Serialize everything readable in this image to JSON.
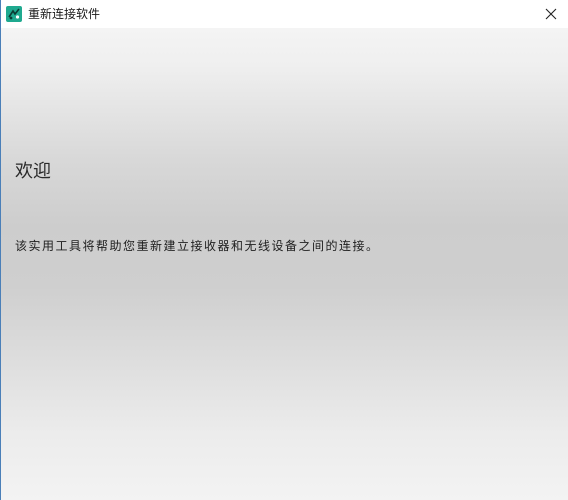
{
  "window": {
    "title": "重新连接软件",
    "icon": "logi-connect-icon",
    "close_label": "×"
  },
  "main": {
    "heading": "欢迎",
    "description": "该实用工具将帮助您重新建立接收器和无线设备之间的连接。"
  },
  "colors": {
    "accent": "#1fa98f",
    "border": "#4a7fb8"
  }
}
